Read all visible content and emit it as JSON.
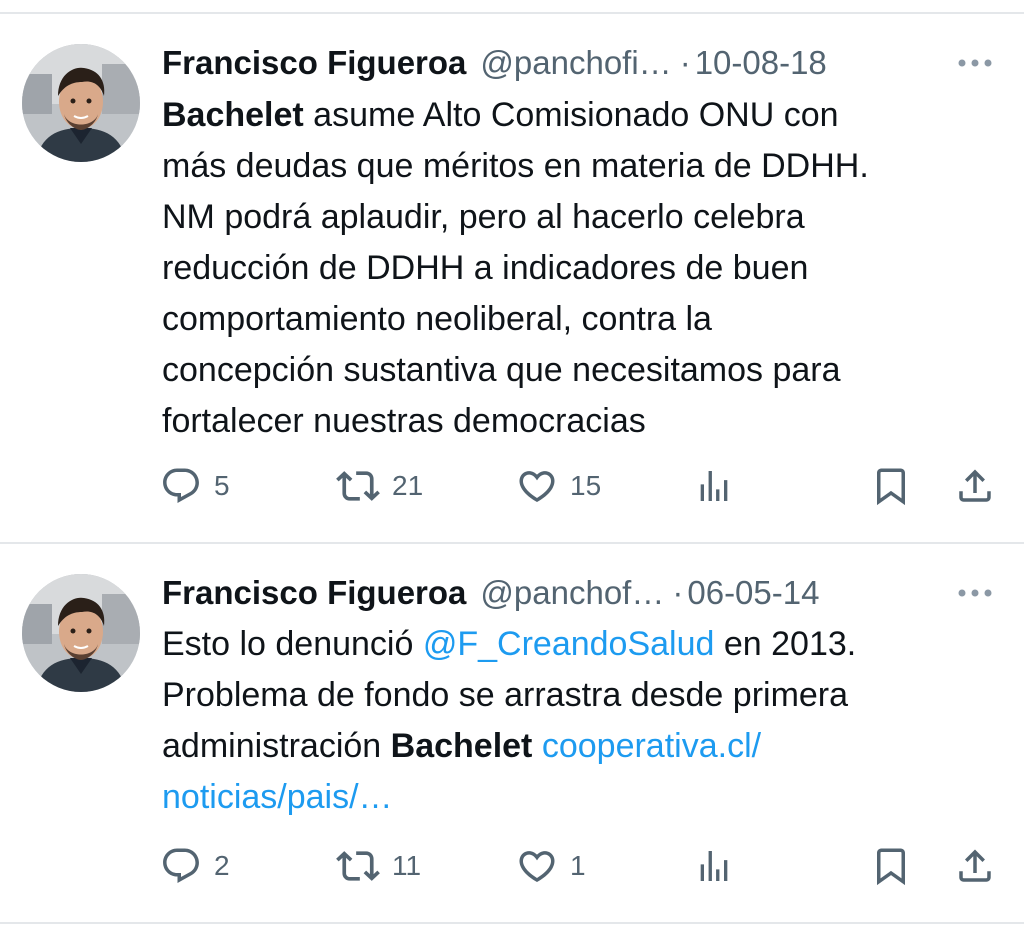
{
  "tweets": [
    {
      "author": "Francisco Figueroa",
      "handle": "@panchofi…",
      "separator": "·",
      "date": "10-08-18",
      "lines": [
        [
          {
            "t": "Bachelet",
            "s": "bold"
          },
          {
            "t": " asume Alto Comisionado ONU con",
            "s": "plain"
          }
        ],
        [
          {
            "t": "más deudas que méritos en materia de DDHH.",
            "s": "plain"
          }
        ],
        [
          {
            "t": "NM podrá aplaudir, pero al hacerlo celebra",
            "s": "plain"
          }
        ],
        [
          {
            "t": "reducción de DDHH a indicadores de buen",
            "s": "plain"
          }
        ],
        [
          {
            "t": "comportamiento neoliberal, contra la",
            "s": "plain"
          }
        ],
        [
          {
            "t": "concepción sustantiva que necesitamos para",
            "s": "plain"
          }
        ],
        [
          {
            "t": "fortalecer nuestras democracias",
            "s": "plain"
          }
        ]
      ],
      "replies": "5",
      "retweets": "21",
      "likes": "15"
    },
    {
      "author": "Francisco Figueroa",
      "handle": "@panchof…",
      "separator": "·",
      "date": "06-05-14",
      "lines": [
        [
          {
            "t": "Esto lo denunció ",
            "s": "plain"
          },
          {
            "t": "@F_CreandoSalud",
            "s": "link"
          },
          {
            "t": " en 2013.",
            "s": "plain"
          }
        ],
        [
          {
            "t": "Problema de fondo se arrastra desde primera",
            "s": "plain"
          }
        ],
        [
          {
            "t": "administración ",
            "s": "plain"
          },
          {
            "t": "Bachelet",
            "s": "bold"
          },
          {
            "t": " ",
            "s": "plain"
          },
          {
            "t": "cooperativa.cl/",
            "s": "link"
          }
        ],
        [
          {
            "t": "noticias/pais/…",
            "s": "link"
          }
        ]
      ],
      "replies": "2",
      "retweets": "11",
      "likes": "1"
    }
  ],
  "icons": {
    "reply": "reply-icon",
    "retweet": "retweet-icon",
    "like": "like-icon",
    "views": "views-icon",
    "bookmark": "bookmark-icon",
    "share": "share-icon",
    "more": "more-icon"
  },
  "colors": {
    "text": "#0f1419",
    "secondary": "#536471",
    "link": "#1d9bf0",
    "divider": "#e4e7ea"
  }
}
